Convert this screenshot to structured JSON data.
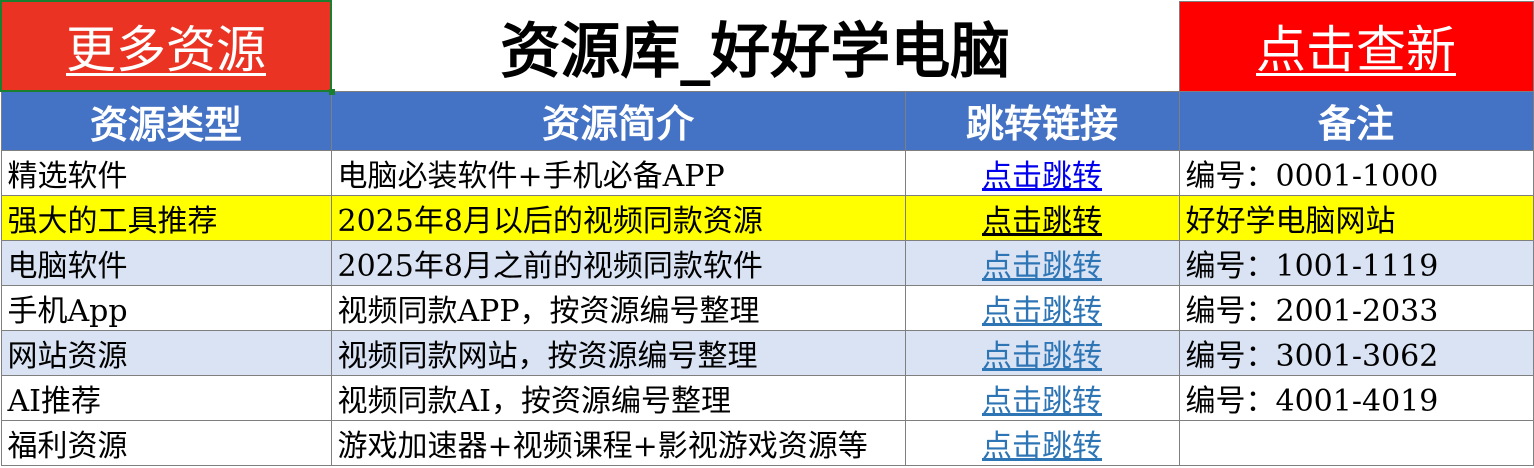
{
  "header": {
    "more_resources": "更多资源",
    "title": "资源库_好好学电脑",
    "check_new": "点击查新"
  },
  "columns": [
    "资源类型",
    "资源简介",
    "跳转链接",
    "备注"
  ],
  "rows": [
    {
      "type": "精选软件",
      "intro": "电脑必装软件+手机必备APP",
      "link": "点击跳转",
      "note": "编号：0001-1000"
    },
    {
      "type": "强大的工具推荐",
      "intro": "2025年8月以后的视频同款资源",
      "link": "点击跳转",
      "note": "好好学电脑网站"
    },
    {
      "type": "电脑软件",
      "intro": "2025年8月之前的视频同款软件",
      "link": "点击跳转",
      "note": "编号：1001-1119"
    },
    {
      "type": "手机App",
      "intro": "视频同款APP，按资源编号整理",
      "link": "点击跳转",
      "note": "编号：2001-2033"
    },
    {
      "type": "网站资源",
      "intro": "视频同款网站，按资源编号整理",
      "link": "点击跳转",
      "note": "编号：3001-3062"
    },
    {
      "type": "AI推荐",
      "intro": "视频同款AI，按资源编号整理",
      "link": "点击跳转",
      "note": "编号：4001-4019"
    },
    {
      "type": "福利资源",
      "intro": "游戏加速器+视频课程+影视游戏资源等",
      "link": "点击跳转",
      "note": ""
    }
  ],
  "colors": {
    "more_bg": "#ea3323",
    "refresh_bg": "#ff0000",
    "header_bg": "#4472c4",
    "highlight_row": "#ffff00",
    "alt_row": "#dae3f3",
    "link_blue": "#0000ee",
    "link_steel": "#2e75b6"
  }
}
